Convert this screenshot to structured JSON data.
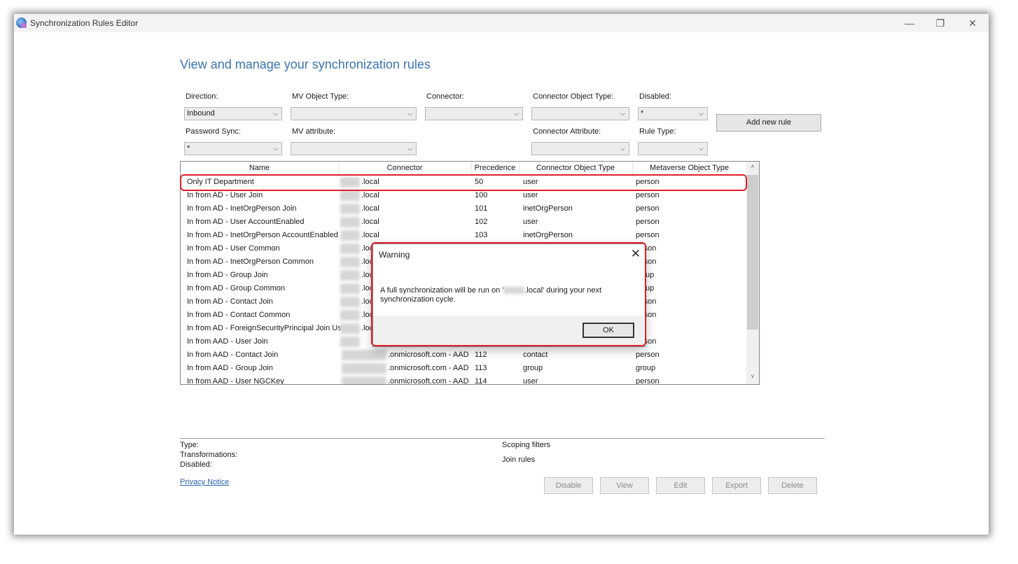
{
  "window": {
    "title": "Synchronization Rules Editor",
    "controls": {
      "minimize": "—",
      "maximize": "❐",
      "close": "✕"
    }
  },
  "page": {
    "heading": "View and manage your synchronization rules"
  },
  "filters": {
    "direction": {
      "label": "Direction:",
      "value": "Inbound"
    },
    "mv_object_type": {
      "label": "MV Object Type:",
      "value": ""
    },
    "connector": {
      "label": "Connector:",
      "value": ""
    },
    "connector_object_type": {
      "label": "Connector Object Type:",
      "value": ""
    },
    "disabled": {
      "label": "Disabled:",
      "value": "*"
    },
    "password_sync": {
      "label": "Password Sync:",
      "value": "*"
    },
    "mv_attribute": {
      "label": "MV attribute:",
      "value": ""
    },
    "connector_attribute": {
      "label": "Connector Attribute:",
      "value": ""
    },
    "rule_type": {
      "label": "Rule Type:",
      "value": ""
    },
    "add_new_rule_label": "Add new rule"
  },
  "table": {
    "columns": [
      "Name",
      "Connector",
      "Precedence",
      "Connector Object Type",
      "Metaverse Object Type"
    ],
    "rows": [
      {
        "name": "Only IT Department",
        "connector": ".local",
        "precedence": "50",
        "cot": "user",
        "mot": "person"
      },
      {
        "name": "In from AD - User Join",
        "connector": ".local",
        "precedence": "100",
        "cot": "user",
        "mot": "person"
      },
      {
        "name": "In from AD - InetOrgPerson Join",
        "connector": ".local",
        "precedence": "101",
        "cot": "inetOrgPerson",
        "mot": "person"
      },
      {
        "name": "In from AD - User AccountEnabled",
        "connector": ".local",
        "precedence": "102",
        "cot": "user",
        "mot": "person"
      },
      {
        "name": "In from AD - InetOrgPerson AccountEnabled",
        "connector": ".local",
        "precedence": "103",
        "cot": "inetOrgPerson",
        "mot": "person"
      },
      {
        "name": "In from AD - User Common",
        "connector": ".loc",
        "precedence": "",
        "cot": "",
        "mot": "rson"
      },
      {
        "name": "In from AD - InetOrgPerson Common",
        "connector": ".loc",
        "precedence": "",
        "cot": "",
        "mot": "rson"
      },
      {
        "name": "In from AD - Group Join",
        "connector": ".loc",
        "precedence": "",
        "cot": "",
        "mot": "up"
      },
      {
        "name": "In from AD - Group Common",
        "connector": ".loc",
        "precedence": "",
        "cot": "",
        "mot": "up"
      },
      {
        "name": "In from AD - Contact Join",
        "connector": ".loc",
        "precedence": "",
        "cot": "",
        "mot": "rson"
      },
      {
        "name": "In from AD - Contact Common",
        "connector": ".loc",
        "precedence": "",
        "cot": "",
        "mot": "rson"
      },
      {
        "name": "In from AD - ForeignSecurityPrincipal Join Us",
        "connector": ".loc",
        "precedence": "",
        "cot": "",
        "mot": ""
      },
      {
        "name": "In from AAD - User Join",
        "connector": "",
        "precedence": "",
        "cot": "",
        "mot": "rson"
      },
      {
        "name": "In from AAD - Contact Join",
        "connector": ".onmicrosoft.com - AAD",
        "precedence": "112",
        "cot": "contact",
        "mot": "person"
      },
      {
        "name": "In from AAD - Group Join",
        "connector": ".onmicrosoft.com - AAD",
        "precedence": "113",
        "cot": "group",
        "mot": "group"
      },
      {
        "name": "In from AAD - User NGCKey",
        "connector": ".onmicrosoft.com - AAD",
        "precedence": "114",
        "cot": "user",
        "mot": "person"
      }
    ]
  },
  "dialog": {
    "title": "Warning",
    "message_prefix": "A full synchronization will be run on '",
    "message_suffix": ".local' during your next synchronization cycle.",
    "ok_label": "OK"
  },
  "details": {
    "type_label": "Type:",
    "transformations_label": "Transformations:",
    "disabled_label": "Disabled:",
    "scoping_filters_label": "Scoping filters",
    "join_rules_label": "Join rules"
  },
  "footer": {
    "privacy_notice": "Privacy Notice",
    "buttons": {
      "disable": "Disable",
      "view": "View",
      "edit": "Edit",
      "export": "Export",
      "delete": "Delete"
    }
  }
}
